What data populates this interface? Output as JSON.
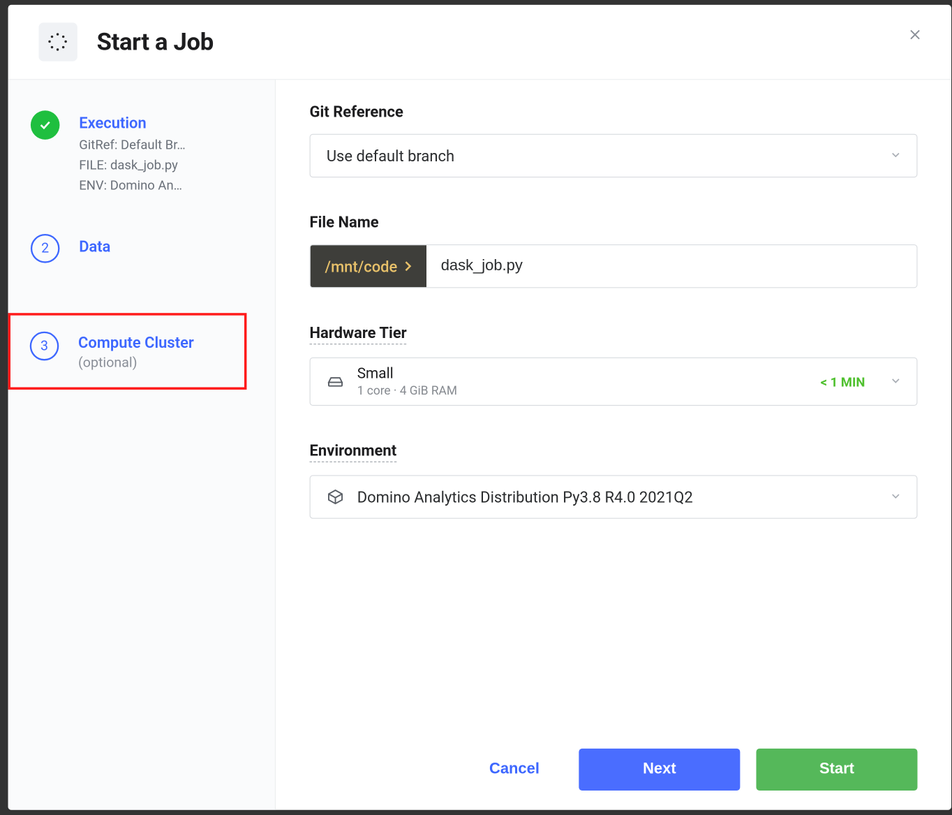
{
  "modal": {
    "title": "Start a Job"
  },
  "steps": {
    "execution": {
      "title": "Execution",
      "sub": "GitRef: Default Br…\nFILE: dask_job.py\nENV: Domino An…"
    },
    "data": {
      "number": "2",
      "title": "Data"
    },
    "compute": {
      "number": "3",
      "title": "Compute Cluster",
      "optional": "(optional)"
    }
  },
  "form": {
    "git_ref_label": "Git Reference",
    "git_ref_value": "Use default branch",
    "file_label": "File Name",
    "file_prefix": "/mnt/code",
    "file_value": "dask_job.py",
    "hw_label": "Hardware Tier",
    "hw_name": "Small",
    "hw_sub": "1 core · 4 GiB RAM",
    "hw_time": "< 1 MIN",
    "env_label": "Environment",
    "env_value": "Domino Analytics Distribution Py3.8 R4.0 2021Q2"
  },
  "buttons": {
    "cancel": "Cancel",
    "next": "Next",
    "start": "Start"
  }
}
